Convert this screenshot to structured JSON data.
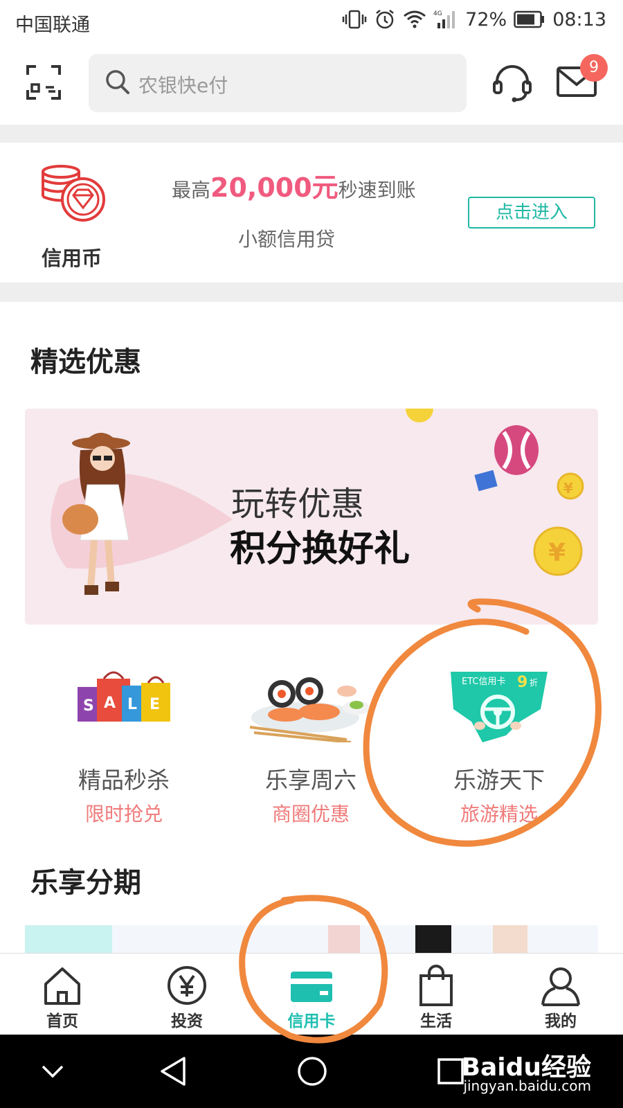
{
  "status_bar": {
    "carrier": "中国联通",
    "battery": "72%",
    "time": "08:13",
    "network": "4G"
  },
  "header": {
    "search_placeholder": "农银快e付",
    "mail_badge": "9"
  },
  "credit_coin": {
    "label": "信用币",
    "promo_prefix": "最高",
    "promo_amount": "20,000元",
    "promo_suffix": "秒速到账",
    "subtitle": "小额信用贷",
    "button": "点击进入"
  },
  "featured": {
    "title": "精选优惠",
    "banner": {
      "line1": "玩转优惠",
      "line2": "积分换好礼"
    },
    "categories": [
      {
        "name": "精品秒杀",
        "sub": "限时抢兑",
        "icon": "shopping-bags-icon"
      },
      {
        "name": "乐享周六",
        "sub": "商圈优惠",
        "icon": "sushi-icon"
      },
      {
        "name": "乐游天下",
        "sub": "旅游精选",
        "icon": "etc-card-icon",
        "badge_text": "ETC信用卡",
        "discount": "9",
        "discount_unit": "折"
      }
    ]
  },
  "installments": {
    "title": "乐享分期"
  },
  "tabs": [
    {
      "label": "首页",
      "icon": "home-icon"
    },
    {
      "label": "投资",
      "icon": "yen-icon"
    },
    {
      "label": "信用卡",
      "icon": "credit-card-icon",
      "active": true
    },
    {
      "label": "生活",
      "icon": "shopping-bag-icon"
    },
    {
      "label": "我的",
      "icon": "user-icon"
    }
  ],
  "watermark": {
    "brand": "Baidu经验",
    "url": "jingyan.baidu.com"
  },
  "colors": {
    "accent": "#1fbfb0",
    "promo": "#f05a7e",
    "annotation": "#f0883e",
    "badge": "#f5675e"
  }
}
